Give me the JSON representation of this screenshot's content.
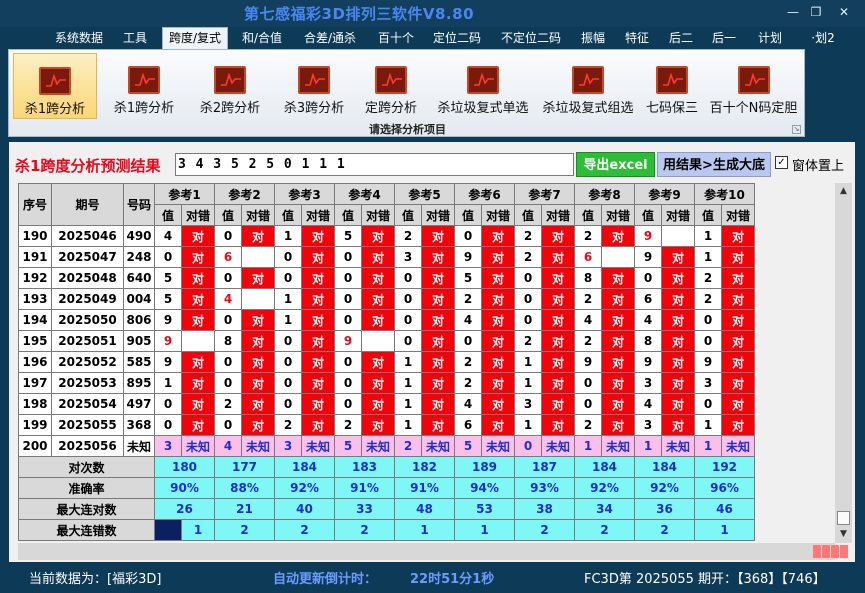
{
  "app_title": "第七感福彩3D排列三软件V8.80",
  "window_controls": {
    "minimize": "—",
    "restore": "❐",
    "close": "✕"
  },
  "menu": [
    "系统数据",
    "工具",
    "跨度/复式",
    "和/合值",
    "合差/通杀",
    "百十个",
    "定位二码",
    "不定位二码",
    "振幅",
    "特征",
    "后二",
    "后一",
    "计划",
    "·划2"
  ],
  "menu_active": 2,
  "ribbon": {
    "buttons": [
      "杀1跨分析",
      "杀1跨分析",
      "杀2跨分析",
      "杀3跨分析",
      "定跨分析",
      "杀垃圾复式单选",
      "杀垃圾复式组选",
      "七码保三",
      "百十个N码定胆"
    ],
    "selected": 0,
    "caption": "请选择分析项目"
  },
  "result": {
    "title": "杀1跨度分析预测结果",
    "value": "3 4 3 5 2 5 0 1 1 1",
    "export_label": "导出excel",
    "generate_label": "用结果>生成大底",
    "topmost_label": "窗体置上",
    "topmost_checked": "✓"
  },
  "table": {
    "h_seq": "序号",
    "h_period": "期号",
    "h_num": "号码",
    "ref_headers": [
      "参考1",
      "参考2",
      "参考3",
      "参考4",
      "参考5",
      "参考6",
      "参考7",
      "参考8",
      "参考9",
      "参考10"
    ],
    "sub_val": "值",
    "sub_dui": "对错",
    "ok_text": "对",
    "rows": [
      {
        "seq": "190",
        "period": "2025046",
        "num": "490",
        "vals": [
          "4",
          "0",
          "1",
          "5",
          "2",
          "0",
          "2",
          "2",
          "9",
          "1"
        ],
        "ok": [
          1,
          1,
          1,
          1,
          1,
          1,
          1,
          1,
          0,
          1
        ]
      },
      {
        "seq": "191",
        "period": "2025047",
        "num": "248",
        "vals": [
          "0",
          "6",
          "0",
          "0",
          "3",
          "9",
          "2",
          "6",
          "9",
          "1"
        ],
        "ok": [
          1,
          0,
          1,
          1,
          1,
          1,
          1,
          0,
          1,
          1
        ]
      },
      {
        "seq": "192",
        "period": "2025048",
        "num": "640",
        "vals": [
          "5",
          "0",
          "0",
          "0",
          "0",
          "5",
          "0",
          "8",
          "0",
          "2"
        ],
        "ok": [
          1,
          1,
          1,
          1,
          1,
          1,
          1,
          1,
          1,
          1
        ]
      },
      {
        "seq": "193",
        "period": "2025049",
        "num": "004",
        "vals": [
          "5",
          "4",
          "1",
          "0",
          "0",
          "2",
          "0",
          "2",
          "6",
          "2"
        ],
        "ok": [
          1,
          0,
          1,
          1,
          1,
          1,
          1,
          1,
          1,
          1
        ]
      },
      {
        "seq": "194",
        "period": "2025050",
        "num": "806",
        "vals": [
          "9",
          "0",
          "1",
          "0",
          "0",
          "4",
          "0",
          "4",
          "4",
          "0"
        ],
        "ok": [
          1,
          1,
          1,
          1,
          1,
          1,
          1,
          1,
          1,
          1
        ]
      },
      {
        "seq": "195",
        "period": "2025051",
        "num": "905",
        "vals": [
          "9",
          "8",
          "0",
          "9",
          "0",
          "0",
          "2",
          "2",
          "8",
          "0"
        ],
        "ok": [
          0,
          1,
          1,
          0,
          1,
          1,
          1,
          1,
          1,
          1
        ]
      },
      {
        "seq": "196",
        "period": "2025052",
        "num": "585",
        "vals": [
          "9",
          "0",
          "0",
          "0",
          "1",
          "2",
          "1",
          "9",
          "9",
          "9"
        ],
        "ok": [
          1,
          1,
          1,
          1,
          1,
          1,
          1,
          1,
          1,
          1
        ]
      },
      {
        "seq": "197",
        "period": "2025053",
        "num": "895",
        "vals": [
          "1",
          "0",
          "0",
          "0",
          "1",
          "2",
          "1",
          "0",
          "3",
          "3"
        ],
        "ok": [
          1,
          1,
          1,
          1,
          1,
          1,
          1,
          1,
          1,
          1
        ]
      },
      {
        "seq": "198",
        "period": "2025054",
        "num": "497",
        "vals": [
          "0",
          "2",
          "0",
          "0",
          "1",
          "4",
          "3",
          "0",
          "4",
          "0"
        ],
        "ok": [
          1,
          1,
          1,
          1,
          1,
          1,
          1,
          1,
          1,
          1
        ]
      },
      {
        "seq": "199",
        "period": "2025055",
        "num": "368",
        "vals": [
          "0",
          "0",
          "2",
          "2",
          "1",
          "6",
          "1",
          "2",
          "3",
          "1"
        ],
        "ok": [
          1,
          1,
          1,
          1,
          1,
          1,
          1,
          1,
          1,
          1
        ]
      }
    ],
    "upcoming": {
      "seq": "200",
      "period": "2025056",
      "num": "未知",
      "vals": [
        "3",
        "4",
        "3",
        "5",
        "2",
        "5",
        "0",
        "1",
        "1",
        "1"
      ],
      "unknown": "未知"
    },
    "stats": [
      {
        "label": "对次数",
        "values": [
          "180",
          "177",
          "184",
          "183",
          "182",
          "189",
          "187",
          "184",
          "184",
          "192"
        ]
      },
      {
        "label": "准确率",
        "values": [
          "90%",
          "88%",
          "92%",
          "91%",
          "91%",
          "94%",
          "93%",
          "92%",
          "92%",
          "96%"
        ]
      },
      {
        "label": "最大连对数",
        "values": [
          "26",
          "21",
          "40",
          "33",
          "48",
          "53",
          "38",
          "34",
          "36",
          "46"
        ]
      },
      {
        "label": "最大连错数",
        "values": [
          "1",
          "2",
          "2",
          "2",
          "1",
          "1",
          "2",
          "2",
          "2",
          "1"
        ]
      }
    ]
  },
  "status": {
    "current": "当前数据为：[福彩3D]",
    "countdown_label": "自动更新倒计时：",
    "countdown_value": "22时51分1秒",
    "draw_info": "FC3D第 2025055 期开：【368】【746】"
  },
  "colors": {
    "ok": "#f2020b",
    "upcoming": "#fbbfeb",
    "stats": "#7ff7f7",
    "accent_text": "#1e2fd0"
  }
}
